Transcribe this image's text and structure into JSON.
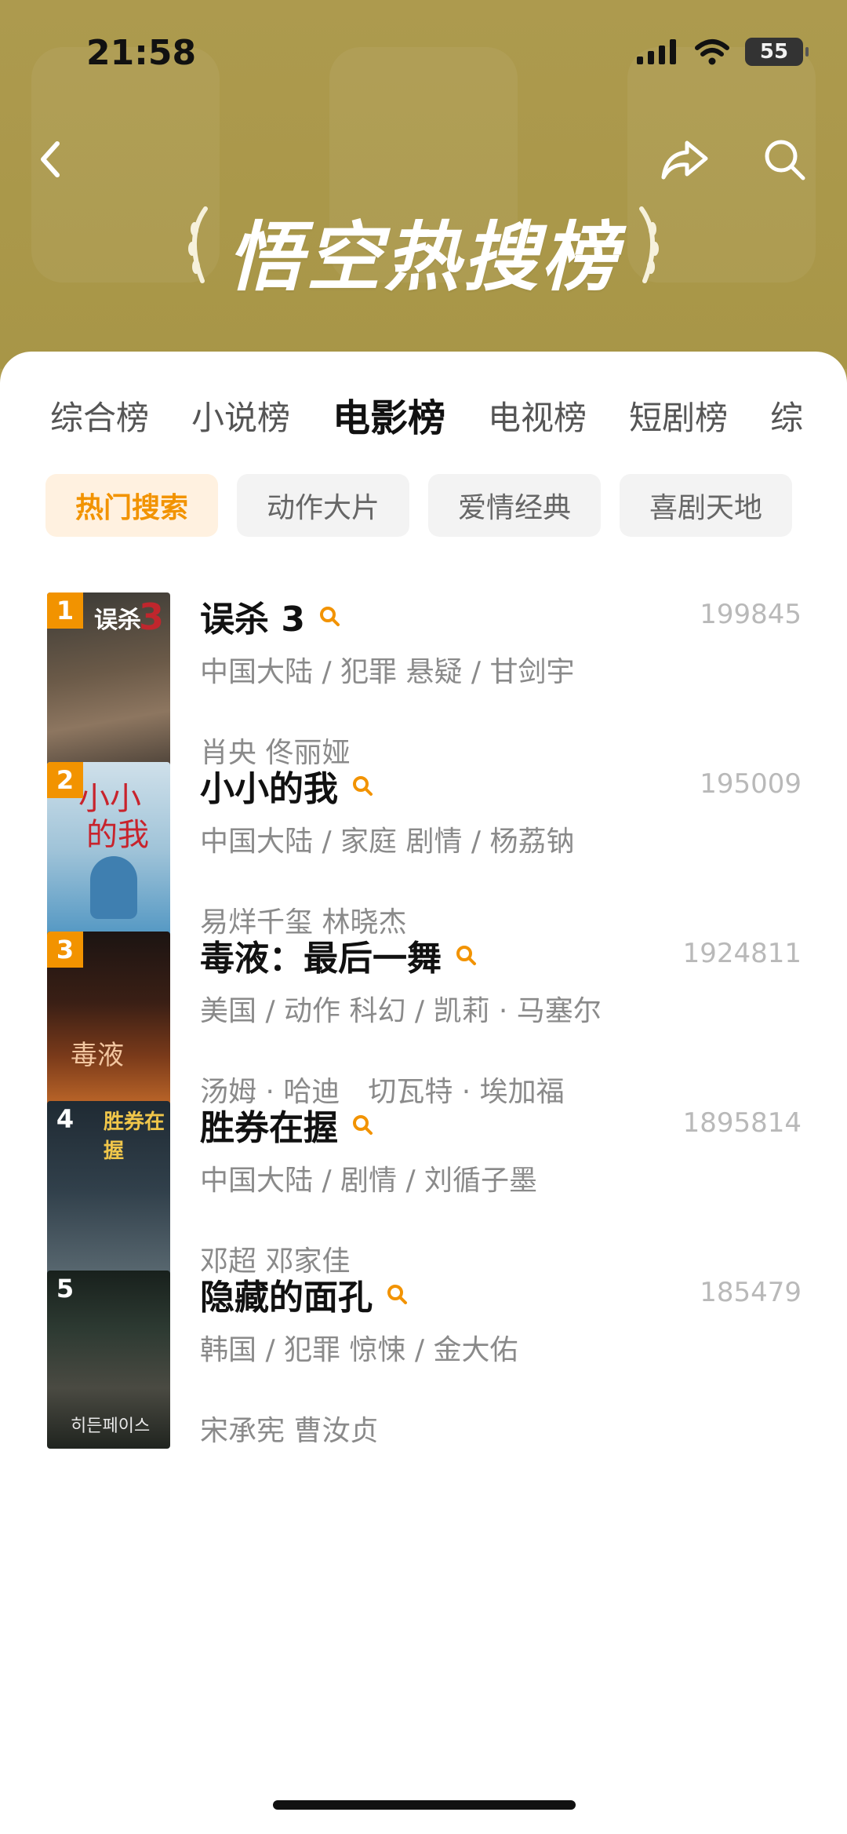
{
  "status": {
    "time": "21:58",
    "battery": "55"
  },
  "banner": {
    "title": "悟空热搜榜"
  },
  "icons": {
    "back": "back-icon",
    "share": "share-icon",
    "search": "search-icon",
    "signal": "signal-icon",
    "wifi": "wifi-icon",
    "battery": "battery-icon"
  },
  "tabs": [
    "综合榜",
    "小说榜",
    "电影榜",
    "电视榜",
    "短剧榜",
    "综"
  ],
  "active_tab": "电影榜",
  "chips": [
    "热门搜索",
    "动作大片",
    "爱情经典",
    "喜剧天地"
  ],
  "active_chip": "热门搜索",
  "items": [
    {
      "rank": "1",
      "title": "误杀 3",
      "score": "199845",
      "meta": "中国大陆 / 犯罪 悬疑 / 甘剑宇",
      "cast": "肖央 佟丽娅"
    },
    {
      "rank": "2",
      "title": "小小的我",
      "score": "195009",
      "meta": "中国大陆 / 家庭 剧情 / 杨荔钠",
      "cast": "易烊千玺 林晓杰"
    },
    {
      "rank": "3",
      "title": "毒液：最后一舞",
      "score": "1924811",
      "meta": "美国 / 动作 科幻 / 凯莉 · 马塞尔",
      "cast": "汤姆 · 哈迪　切瓦特 · 埃加福"
    },
    {
      "rank": "4",
      "title": "胜券在握",
      "score": "1895814",
      "meta": "中国大陆 / 剧情 / 刘循子墨",
      "cast": "邓超 邓家佳"
    },
    {
      "rank": "5",
      "title": "隐藏的面孔",
      "score": "185479",
      "meta": "韩国 / 犯罪 惊悚 / 金大佑",
      "cast": "宋承宪 曹汝贞"
    }
  ],
  "colors": {
    "accent": "#f29300",
    "header": "#ad9a4e"
  }
}
